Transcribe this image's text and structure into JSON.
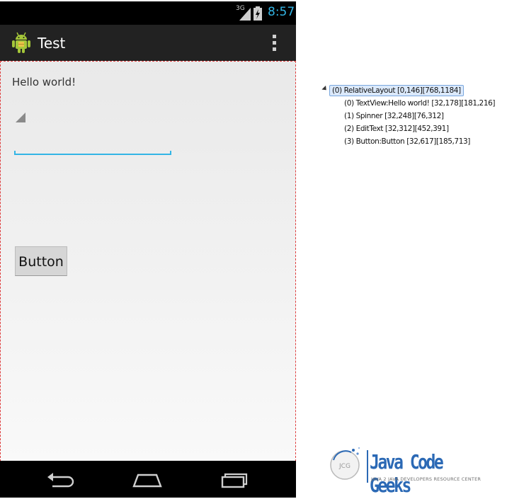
{
  "status_bar": {
    "network_label": "3G",
    "time": "8:57"
  },
  "action_bar": {
    "title": "Test",
    "app_icon": "android-icon",
    "menu_icon": "overflow-menu-icon"
  },
  "content": {
    "hello_text": "Hello world!",
    "button_label": "Button"
  },
  "nav_bar": {
    "back_icon": "back-icon",
    "home_icon": "home-icon",
    "recent_icon": "recent-apps-icon"
  },
  "hierarchy": {
    "root": "(0) RelativeLayout [0,146][768,1184]",
    "children": [
      "(0) TextView:Hello world! [32,178][181,216]",
      "(1) Spinner [32,248][76,312]",
      "(2) EditText [32,312][452,391]",
      "(3) Button:Button [32,617][185,713]"
    ]
  },
  "logo": {
    "name": "Java Code Geeks",
    "tagline": "JAVA 2 JAVA DEVELOPERS RESOURCE CENTER",
    "badge": "JCG"
  },
  "colors": {
    "accent": "#33b5e5",
    "action_bar": "#222222",
    "logo_blue": "#2b69b5"
  }
}
